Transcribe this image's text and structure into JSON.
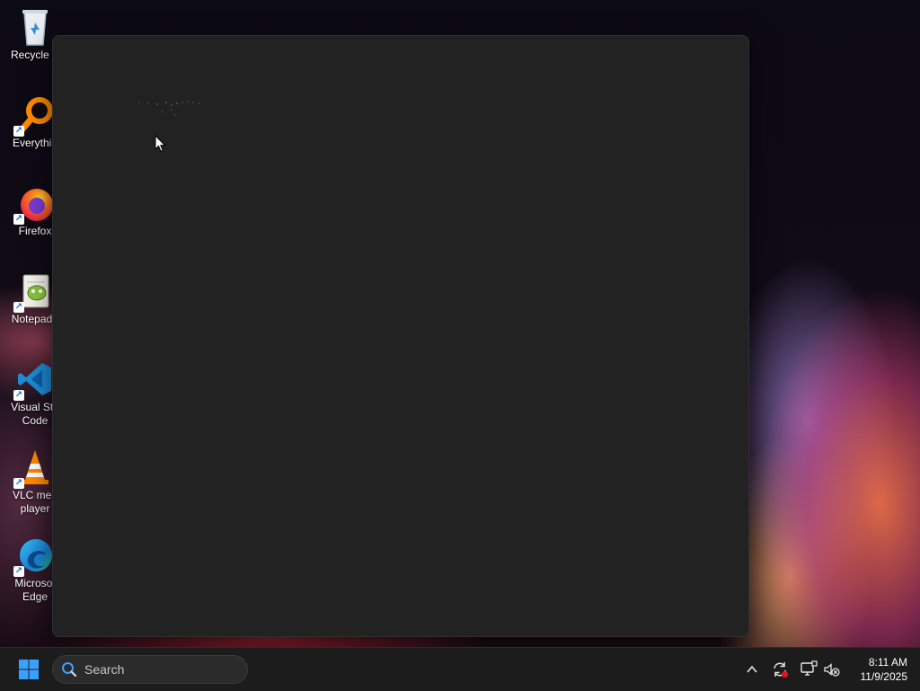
{
  "desktop": {
    "icons": [
      {
        "label": "Recycle B",
        "icon": "recycle-bin-icon"
      },
      {
        "label": "Everythin",
        "icon": "everything-search-icon"
      },
      {
        "label": "Firefox",
        "icon": "firefox-icon"
      },
      {
        "label": "Notepad+",
        "icon": "notepad-plus-plus-icon"
      },
      {
        "label": "Visual Stu\nCode",
        "line1": "Visual Stu",
        "line2": "Code",
        "icon": "vscode-icon"
      },
      {
        "label": "VLC med\nplayer",
        "line1": "VLC med",
        "line2": "player",
        "icon": "vlc-icon"
      },
      {
        "label": "Microso\nEdge",
        "line1": "Microsof",
        "line2": "Edge",
        "icon": "edge-icon"
      }
    ]
  },
  "window": {
    "background": "#222222",
    "state": "loading"
  },
  "taskbar": {
    "search_placeholder": "Search",
    "clock": {
      "time": "8:11 AM",
      "date": "11/9/2025"
    },
    "tray_icons": [
      "chevron-up-icon",
      "sync-icon",
      "network-icon",
      "volume-muted-icon"
    ]
  },
  "colors": {
    "taskbar_bg": "#1c1c1c",
    "window_bg": "#222222",
    "accent_blue": "#3aa0ff",
    "alert_red": "#e81123"
  }
}
